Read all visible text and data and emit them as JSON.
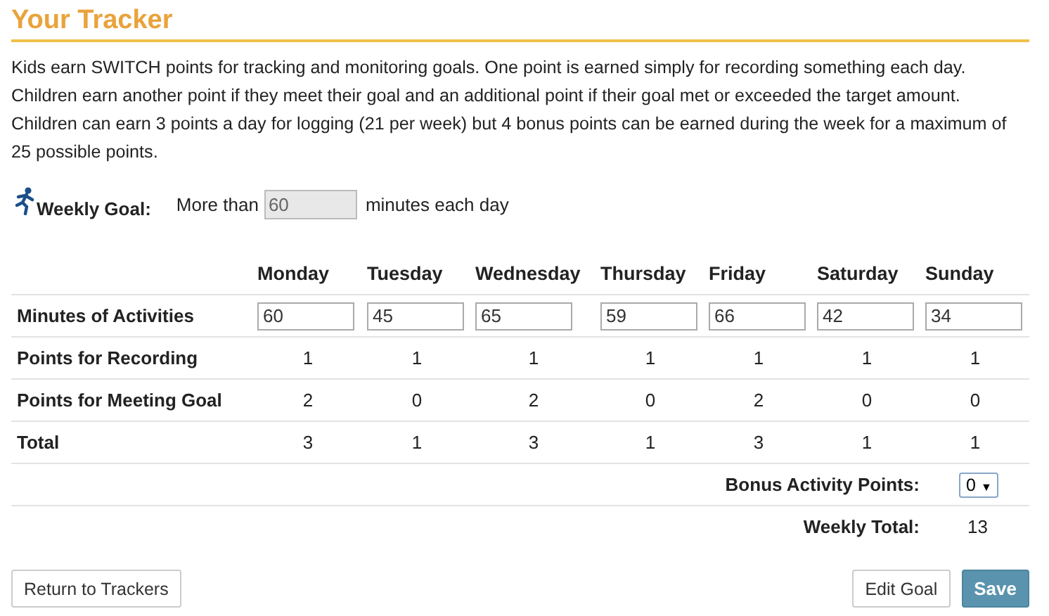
{
  "title": "Your Tracker",
  "intro": "Kids earn SWITCH points for tracking and monitoring goals. One point is earned simply for recording something each day. Children earn another point if they meet their goal and an additional point if their goal met or exceeded the target amount. Children can earn 3 points a day for logging (21 per week) but 4 bonus points can be earned during the week for a maximum of 25 possible points.",
  "goal": {
    "label": "Weekly Goal:",
    "prefix": "More than",
    "value": "60",
    "suffix": "minutes each day"
  },
  "row_labels": {
    "minutes": "Minutes of Activities",
    "recording": "Points for Recording",
    "meeting_goal": "Points for Meeting Goal",
    "total": "Total"
  },
  "days": [
    {
      "name": "Monday",
      "minutes": "60",
      "recording": "1",
      "meeting_goal": "2",
      "total": "3"
    },
    {
      "name": "Tuesday",
      "minutes": "45",
      "recording": "1",
      "meeting_goal": "0",
      "total": "1"
    },
    {
      "name": "Wednesday",
      "minutes": "65",
      "recording": "1",
      "meeting_goal": "2",
      "total": "3"
    },
    {
      "name": "Thursday",
      "minutes": "59",
      "recording": "1",
      "meeting_goal": "0",
      "total": "1"
    },
    {
      "name": "Friday",
      "minutes": "66",
      "recording": "1",
      "meeting_goal": "2",
      "total": "3"
    },
    {
      "name": "Saturday",
      "minutes": "42",
      "recording": "1",
      "meeting_goal": "0",
      "total": "1"
    },
    {
      "name": "Sunday",
      "minutes": "34",
      "recording": "1",
      "meeting_goal": "0",
      "total": "1"
    }
  ],
  "bonus": {
    "label": "Bonus Activity Points:",
    "value": "0",
    "arrow": "▼"
  },
  "weekly_total": {
    "label": "Weekly Total:",
    "value": "13"
  },
  "buttons": {
    "return": "Return to Trackers",
    "edit": "Edit Goal",
    "save": "Save"
  }
}
